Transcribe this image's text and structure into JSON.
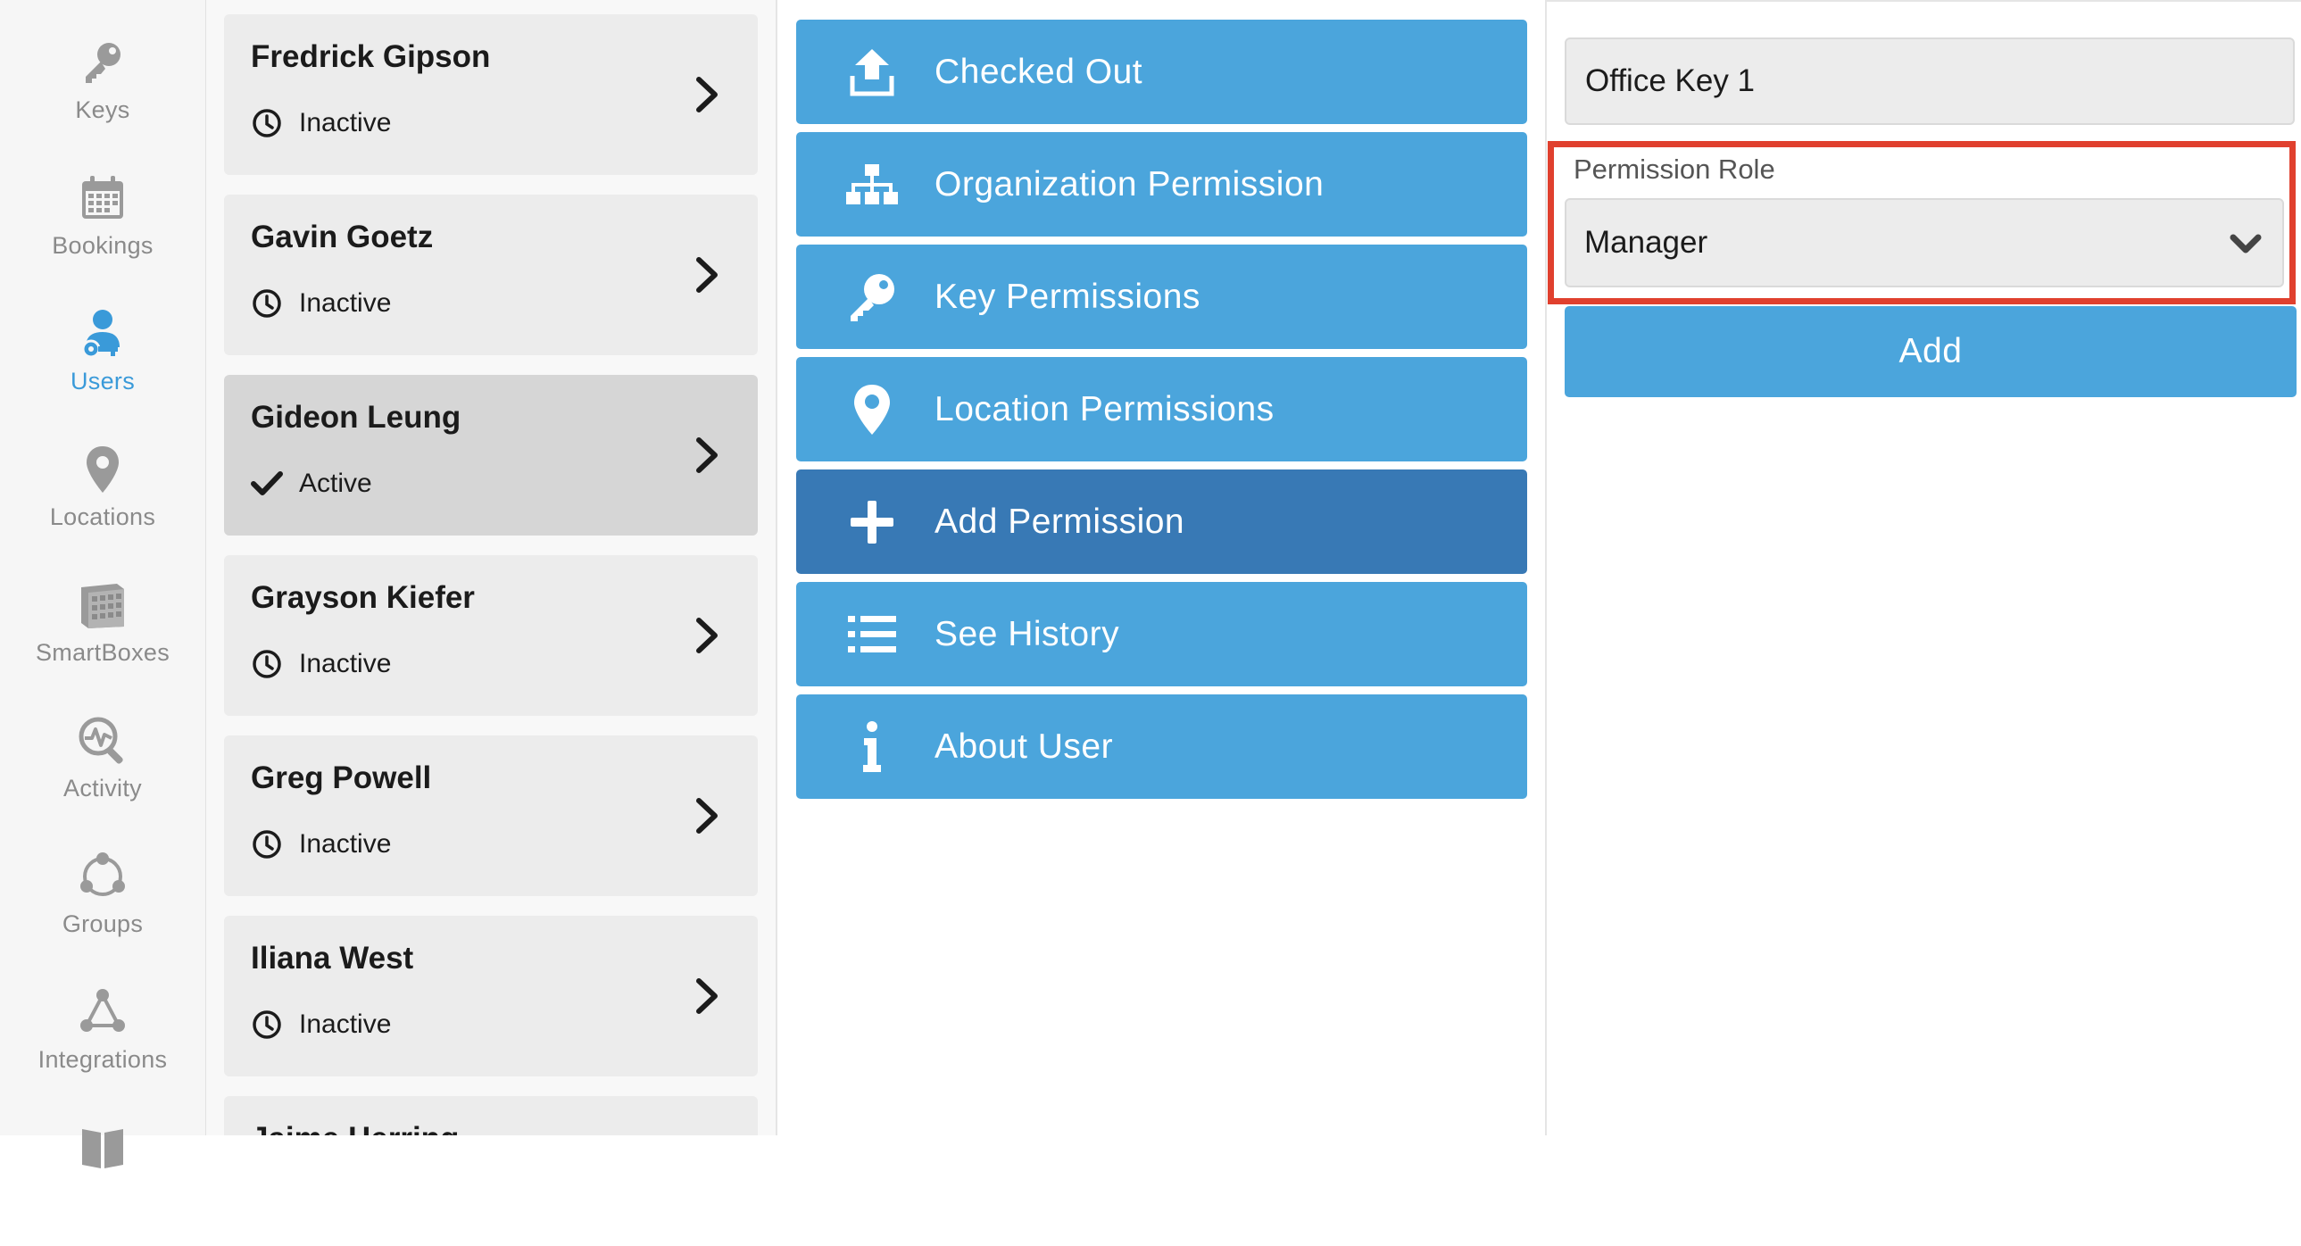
{
  "nav": {
    "items": [
      {
        "label": "Keys",
        "icon": "key-icon",
        "active": false
      },
      {
        "label": "Bookings",
        "icon": "calendar-icon",
        "active": false
      },
      {
        "label": "Users",
        "icon": "users-icon",
        "active": true
      },
      {
        "label": "Locations",
        "icon": "map-pin-icon",
        "active": false
      },
      {
        "label": "SmartBoxes",
        "icon": "smartbox-icon",
        "active": false
      },
      {
        "label": "Activity",
        "icon": "activity-icon",
        "active": false
      },
      {
        "label": "Groups",
        "icon": "groups-icon",
        "active": false
      },
      {
        "label": "Integrations",
        "icon": "integrations-icon",
        "active": false
      }
    ],
    "accent_color": "#3a9ad9"
  },
  "users": [
    {
      "name": "Fredrick Gipson",
      "status": "Inactive",
      "status_icon": "clock-icon"
    },
    {
      "name": "Gavin Goetz",
      "status": "Inactive",
      "status_icon": "clock-icon"
    },
    {
      "name": "Gideon Leung",
      "status": "Active",
      "status_icon": "check-icon",
      "selected": true
    },
    {
      "name": "Grayson Kiefer",
      "status": "Inactive",
      "status_icon": "clock-icon"
    },
    {
      "name": "Greg Powell",
      "status": "Inactive",
      "status_icon": "clock-icon"
    },
    {
      "name": "Iliana West",
      "status": "Inactive",
      "status_icon": "clock-icon"
    },
    {
      "name": "Jaime Herring",
      "status": "",
      "status_icon": ""
    }
  ],
  "menu": {
    "items": [
      {
        "label": "Checked Out",
        "icon": "upload-icon"
      },
      {
        "label": "Organization Permission",
        "icon": "org-chart-icon"
      },
      {
        "label": "Key Permissions",
        "icon": "key-icon"
      },
      {
        "label": "Location Permissions",
        "icon": "map-pin-icon"
      },
      {
        "label": "Add Permission",
        "icon": "plus-icon",
        "active": true
      },
      {
        "label": "See History",
        "icon": "list-icon"
      },
      {
        "label": "About User",
        "icon": "info-icon"
      }
    ],
    "button_color": "#4ba5dc",
    "active_color": "#3879b5"
  },
  "form": {
    "key_value": "Office Key 1",
    "role_label": "Permission Role",
    "role_value": "Manager",
    "add_label": "Add",
    "highlight_color": "#e0402e"
  }
}
